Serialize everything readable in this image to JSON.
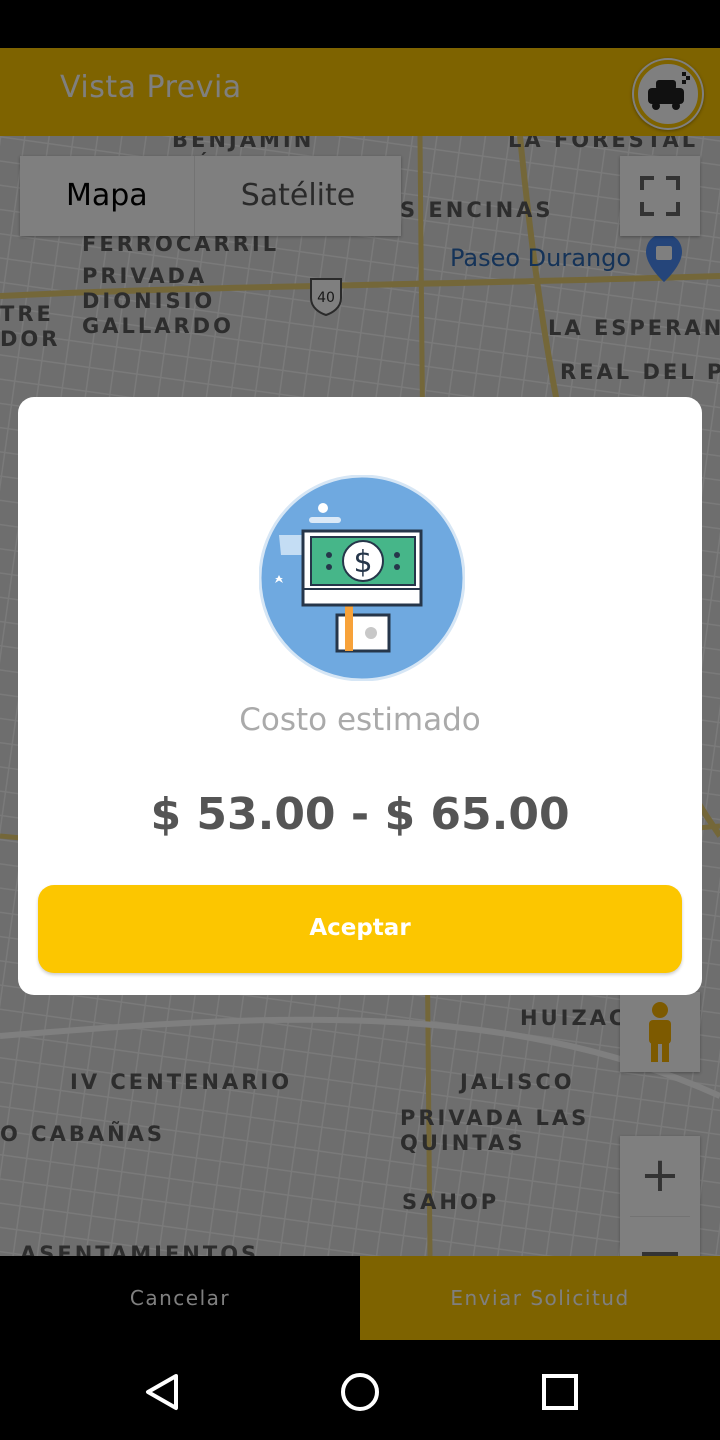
{
  "app_bar": {
    "title": "Vista Previa",
    "logo_icon": "taxi-logo-icon"
  },
  "map": {
    "type_tabs": [
      {
        "label": "Mapa",
        "active": true
      },
      {
        "label": "Satélite",
        "active": false
      }
    ],
    "fullscreen_icon": "fullscreen-icon",
    "pegman_icon": "street-view-pegman-icon",
    "zoom_in_label": "+",
    "highway_shield": "40",
    "place_labels": [
      {
        "text": "BENJAMIN\nMÉNDEZ"
      },
      {
        "text": "LA FORESTAL"
      },
      {
        "text": "S ENCINAS"
      },
      {
        "text": "FERROCARRIL"
      },
      {
        "text": "PRIVADA\nDIONISIO\nGALLARDO"
      },
      {
        "text": "TRE\nDOR"
      },
      {
        "text": "LA ESPERAN"
      },
      {
        "text": "REAL DEL P"
      },
      {
        "text": "Paseo Durango"
      },
      {
        "text": "HUIZAC"
      },
      {
        "text": "IV CENTENARIO"
      },
      {
        "text": "JALISCO"
      },
      {
        "text": "PRIVADA LAS\nQUINTAS"
      },
      {
        "text": "O CABAÑAS"
      },
      {
        "text": "SAHOP"
      },
      {
        "text": "ASENTAMIENTOS"
      }
    ]
  },
  "dialog": {
    "icon": "money-sign-icon",
    "title": "Costo estimado",
    "price": "$ 53.00 - $ 65.00",
    "accept_label": "Aceptar"
  },
  "bottom_bar": {
    "cancel_label": "Cancelar",
    "send_label": "Enviar Solicitud"
  },
  "nav": {
    "back_icon": "back-triangle-icon",
    "home_icon": "home-circle-icon",
    "recents_icon": "recents-square-icon"
  },
  "colors": {
    "accent": "#fcc600",
    "dim_overlay": "rgba(0,0,0,0.5)"
  }
}
